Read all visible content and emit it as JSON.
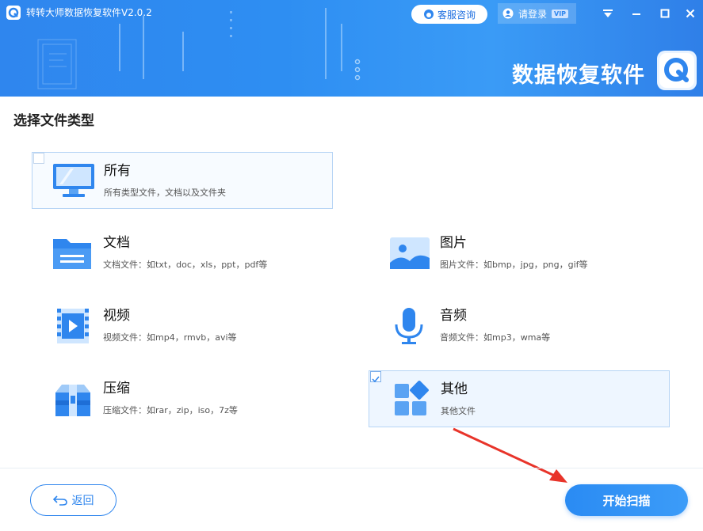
{
  "header": {
    "app_title": "转转大师数据恢复软件V2.0.2",
    "service_label": "客服咨询",
    "login_label": "请登录",
    "vip_badge": "VIP",
    "brand_text": "数据恢复软件",
    "window_buttons": [
      "menu-icon",
      "minimize-icon",
      "maximize-icon",
      "close-icon"
    ]
  },
  "main": {
    "section_title": "选择文件类型",
    "file_types": [
      {
        "id": "all",
        "name": "所有",
        "desc": "所有类型文件，文档以及文件夹",
        "icon": "monitor-icon",
        "checked": false
      },
      {
        "id": "doc",
        "name": "文档",
        "desc": "文档文件：如txt，doc，xls，ppt，pdf等",
        "icon": "folder-icon",
        "checked": false
      },
      {
        "id": "image",
        "name": "图片",
        "desc": "图片文件：如bmp，jpg，png，gif等",
        "icon": "image-icon",
        "checked": false
      },
      {
        "id": "video",
        "name": "视频",
        "desc": "视频文件：如mp4，rmvb，avi等",
        "icon": "video-icon",
        "checked": false
      },
      {
        "id": "audio",
        "name": "音频",
        "desc": "音频文件：如mp3，wma等",
        "icon": "microphone-icon",
        "checked": false
      },
      {
        "id": "archive",
        "name": "压缩",
        "desc": "压缩文件：如rar，zip，iso，7z等",
        "icon": "archive-icon",
        "checked": false
      },
      {
        "id": "other",
        "name": "其他",
        "desc": "其他文件",
        "icon": "other-apps-icon",
        "checked": true
      }
    ]
  },
  "footer": {
    "back_label": "返回",
    "scan_label": "开始扫描"
  },
  "colors": {
    "accent": "#2f86ee",
    "selected_bg": "#eef6ff",
    "arrow": "#e8342a"
  }
}
